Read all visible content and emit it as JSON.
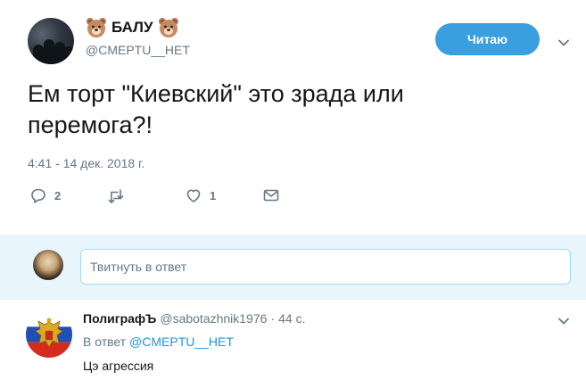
{
  "tweet": {
    "display_name": "БАЛУ",
    "name_emoji": "bear-face-icon",
    "handle": "@CMEPTU__HET",
    "follow_button": "Читаю",
    "text": "Ем торт \"Киевский\" это зрада или перемога?!",
    "timestamp": "4:41 - 14 дек. 2018 г.",
    "actions": {
      "reply_count": "2",
      "retweet_count": "",
      "like_count": "1"
    }
  },
  "reply_box": {
    "placeholder": "Твитнуть в ответ"
  },
  "reply": {
    "display_name": "ПолиграфЪ",
    "handle": "@sabotazhnik1976",
    "separator": "·",
    "time": "44 с.",
    "in_reply_prefix": "В ответ",
    "in_reply_mention": "@CMEPTU__HET",
    "text": "Цэ агрессия"
  },
  "colors": {
    "accent": "#1b95e0",
    "button": "#3a9fdf",
    "secondary_text": "#657786",
    "reply_area_bg": "#e8f5fd"
  }
}
